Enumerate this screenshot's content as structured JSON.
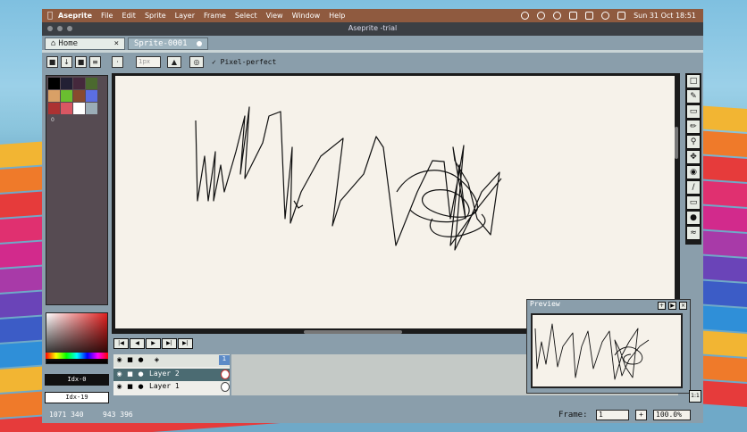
{
  "menubar": {
    "app_name": "Aseprite",
    "items": [
      "File",
      "Edit",
      "Sprite",
      "Layer",
      "Frame",
      "Select",
      "View",
      "Window",
      "Help"
    ],
    "clock": "Sun 31 Oct  18:51",
    "accent": "#8f5a3f"
  },
  "window": {
    "title": "Aseprite -trial"
  },
  "tabs": [
    {
      "label": "Home",
      "icon": "home-icon",
      "close": "×"
    },
    {
      "label": "Sprite-0001"
    }
  ],
  "toolbar": {
    "brush_size_value": "1px",
    "pixel_perfect_label": "Pixel-perfect",
    "pixel_perfect_checked": true
  },
  "palette": {
    "colors": [
      "#000000",
      "#222034",
      "#45283c",
      "#4b692f",
      "#d9a066",
      "#6abe30",
      "#884a2e",
      "#5b6ee1",
      "#ac3232",
      "#d95763",
      "#ffffff",
      "#9badb7",
      "#76428a",
      "#cbdbfc"
    ],
    "index_label": "0"
  },
  "color_bar": {
    "fg_index": "Idx-0",
    "bg_index": "Idx-19"
  },
  "timeline": {
    "frame_number": "1",
    "layers": [
      {
        "name": "Layer 2",
        "selected": true
      },
      {
        "name": "Layer 1",
        "selected": false
      }
    ]
  },
  "preview": {
    "title": "Preview"
  },
  "status": {
    "position": "1071 340",
    "size": "943 396",
    "frame_label": "Frame:",
    "frame_value": "1",
    "zoom": "100.0%"
  }
}
